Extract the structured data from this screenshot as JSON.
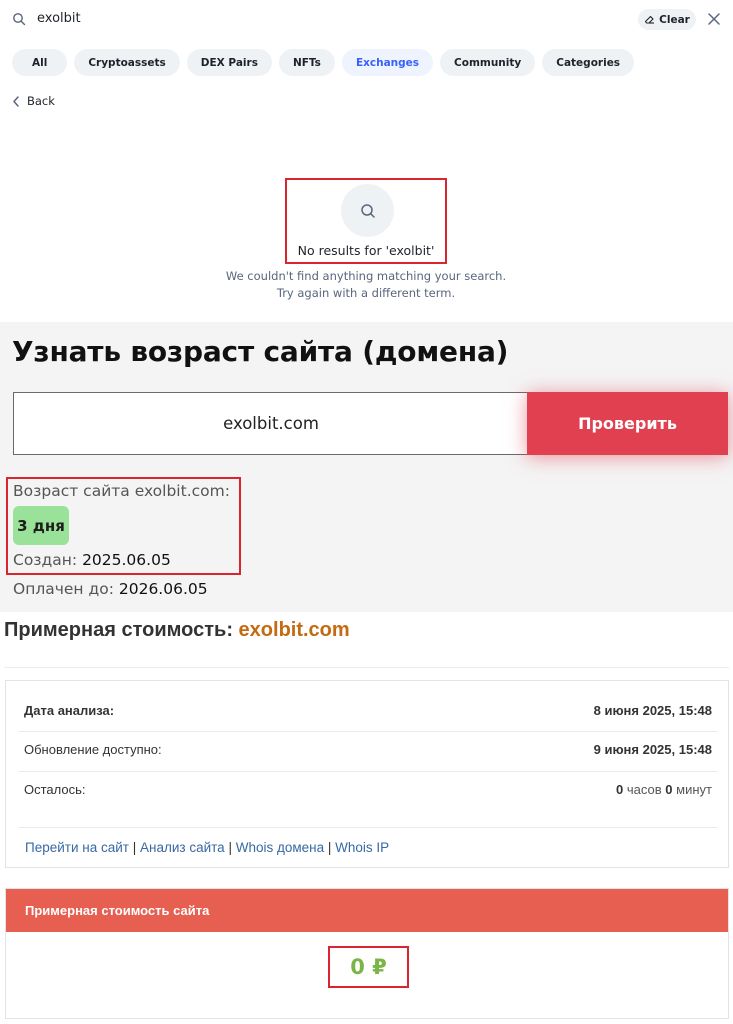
{
  "search": {
    "query": "exolbit",
    "clear_label": "Clear"
  },
  "filters": [
    {
      "label": "All",
      "active": false
    },
    {
      "label": "Cryptoassets",
      "active": false
    },
    {
      "label": "DEX Pairs",
      "active": false
    },
    {
      "label": "NFTs",
      "active": false
    },
    {
      "label": "Exchanges",
      "active": true
    },
    {
      "label": "Community",
      "active": false
    },
    {
      "label": "Categories",
      "active": false
    }
  ],
  "back_label": "Back",
  "empty_state": {
    "title": "No results for 'exolbit'",
    "line1": "We couldn't find anything matching your search.",
    "line2": "Try again with a different term."
  },
  "domain_age": {
    "title": "Узнать возраст сайта (домена)",
    "input_value": "exolbit.com",
    "check_button": "Проверить",
    "age_label": "Возраст сайта exolbit.com:",
    "age_value": "3 дня",
    "created_label": "Создан:",
    "created_value": "2025.06.05",
    "paid_label": "Оплачен до:",
    "paid_value": "2026.06.05"
  },
  "estimate": {
    "heading": "Примерная стоимость:",
    "domain": "exolbit.com",
    "rows": [
      {
        "key": "Дата анализа:",
        "value": "8 июня 2025, 15:48"
      },
      {
        "key": "Обновление доступно:",
        "value": "9 июня 2025, 15:48"
      },
      {
        "key": "Осталось:",
        "hours": "0",
        "hours_unit": "часов",
        "minutes": "0",
        "minutes_unit": "минут"
      }
    ],
    "links": [
      "Перейти на сайт",
      "Анализ сайта",
      "Whois домена",
      "Whois IP"
    ],
    "link_separator": "|",
    "price_header": "Примерная стоимость сайта",
    "price_value": "0 ₽"
  },
  "colors": {
    "accent_blue": "#3861fb",
    "highlight_red": "#d9252f",
    "check_button": "#e0404f",
    "price_header": "#e65f50",
    "age_badge": "#9ae19a",
    "domain_orange": "#c46a11",
    "price_green": "#7ab547"
  },
  "icons": {
    "search": "search-icon",
    "clear": "eraser-icon",
    "close": "close-icon",
    "back": "chevron-left-icon"
  }
}
